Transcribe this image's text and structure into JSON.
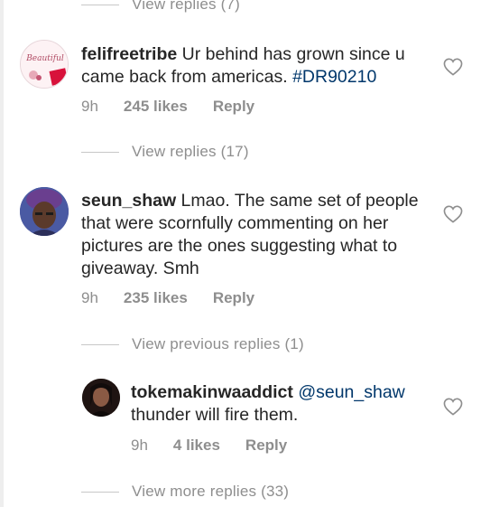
{
  "view_replies_top": "View replies (7)",
  "comments": [
    {
      "username": "felifreetribe",
      "text": " Ur behind has grown since u came back from americas. ",
      "hashtag": "#DR90210",
      "time": "9h",
      "likes": "245 likes",
      "reply": "Reply",
      "avatar_text": "Beautiful",
      "view_replies": "View replies (17)"
    },
    {
      "username": "seun_shaw",
      "text": " Lmao. The same set of people that were scornfully commenting on her pictures are the ones suggesting what to giveaway. Smh",
      "time": "9h",
      "likes": "235 likes",
      "reply": "Reply",
      "view_previous": "View previous replies (1)"
    }
  ],
  "reply": {
    "username": "tokemakinwaaddict",
    "mention": "@seun_shaw",
    "text": "thunder will fire them.",
    "time": "9h",
    "likes": "4 likes",
    "reply": "Reply",
    "view_more": "View more replies (33)"
  },
  "colors": {
    "text": "#262626",
    "muted": "#8e8e8e",
    "link": "#00376b"
  }
}
